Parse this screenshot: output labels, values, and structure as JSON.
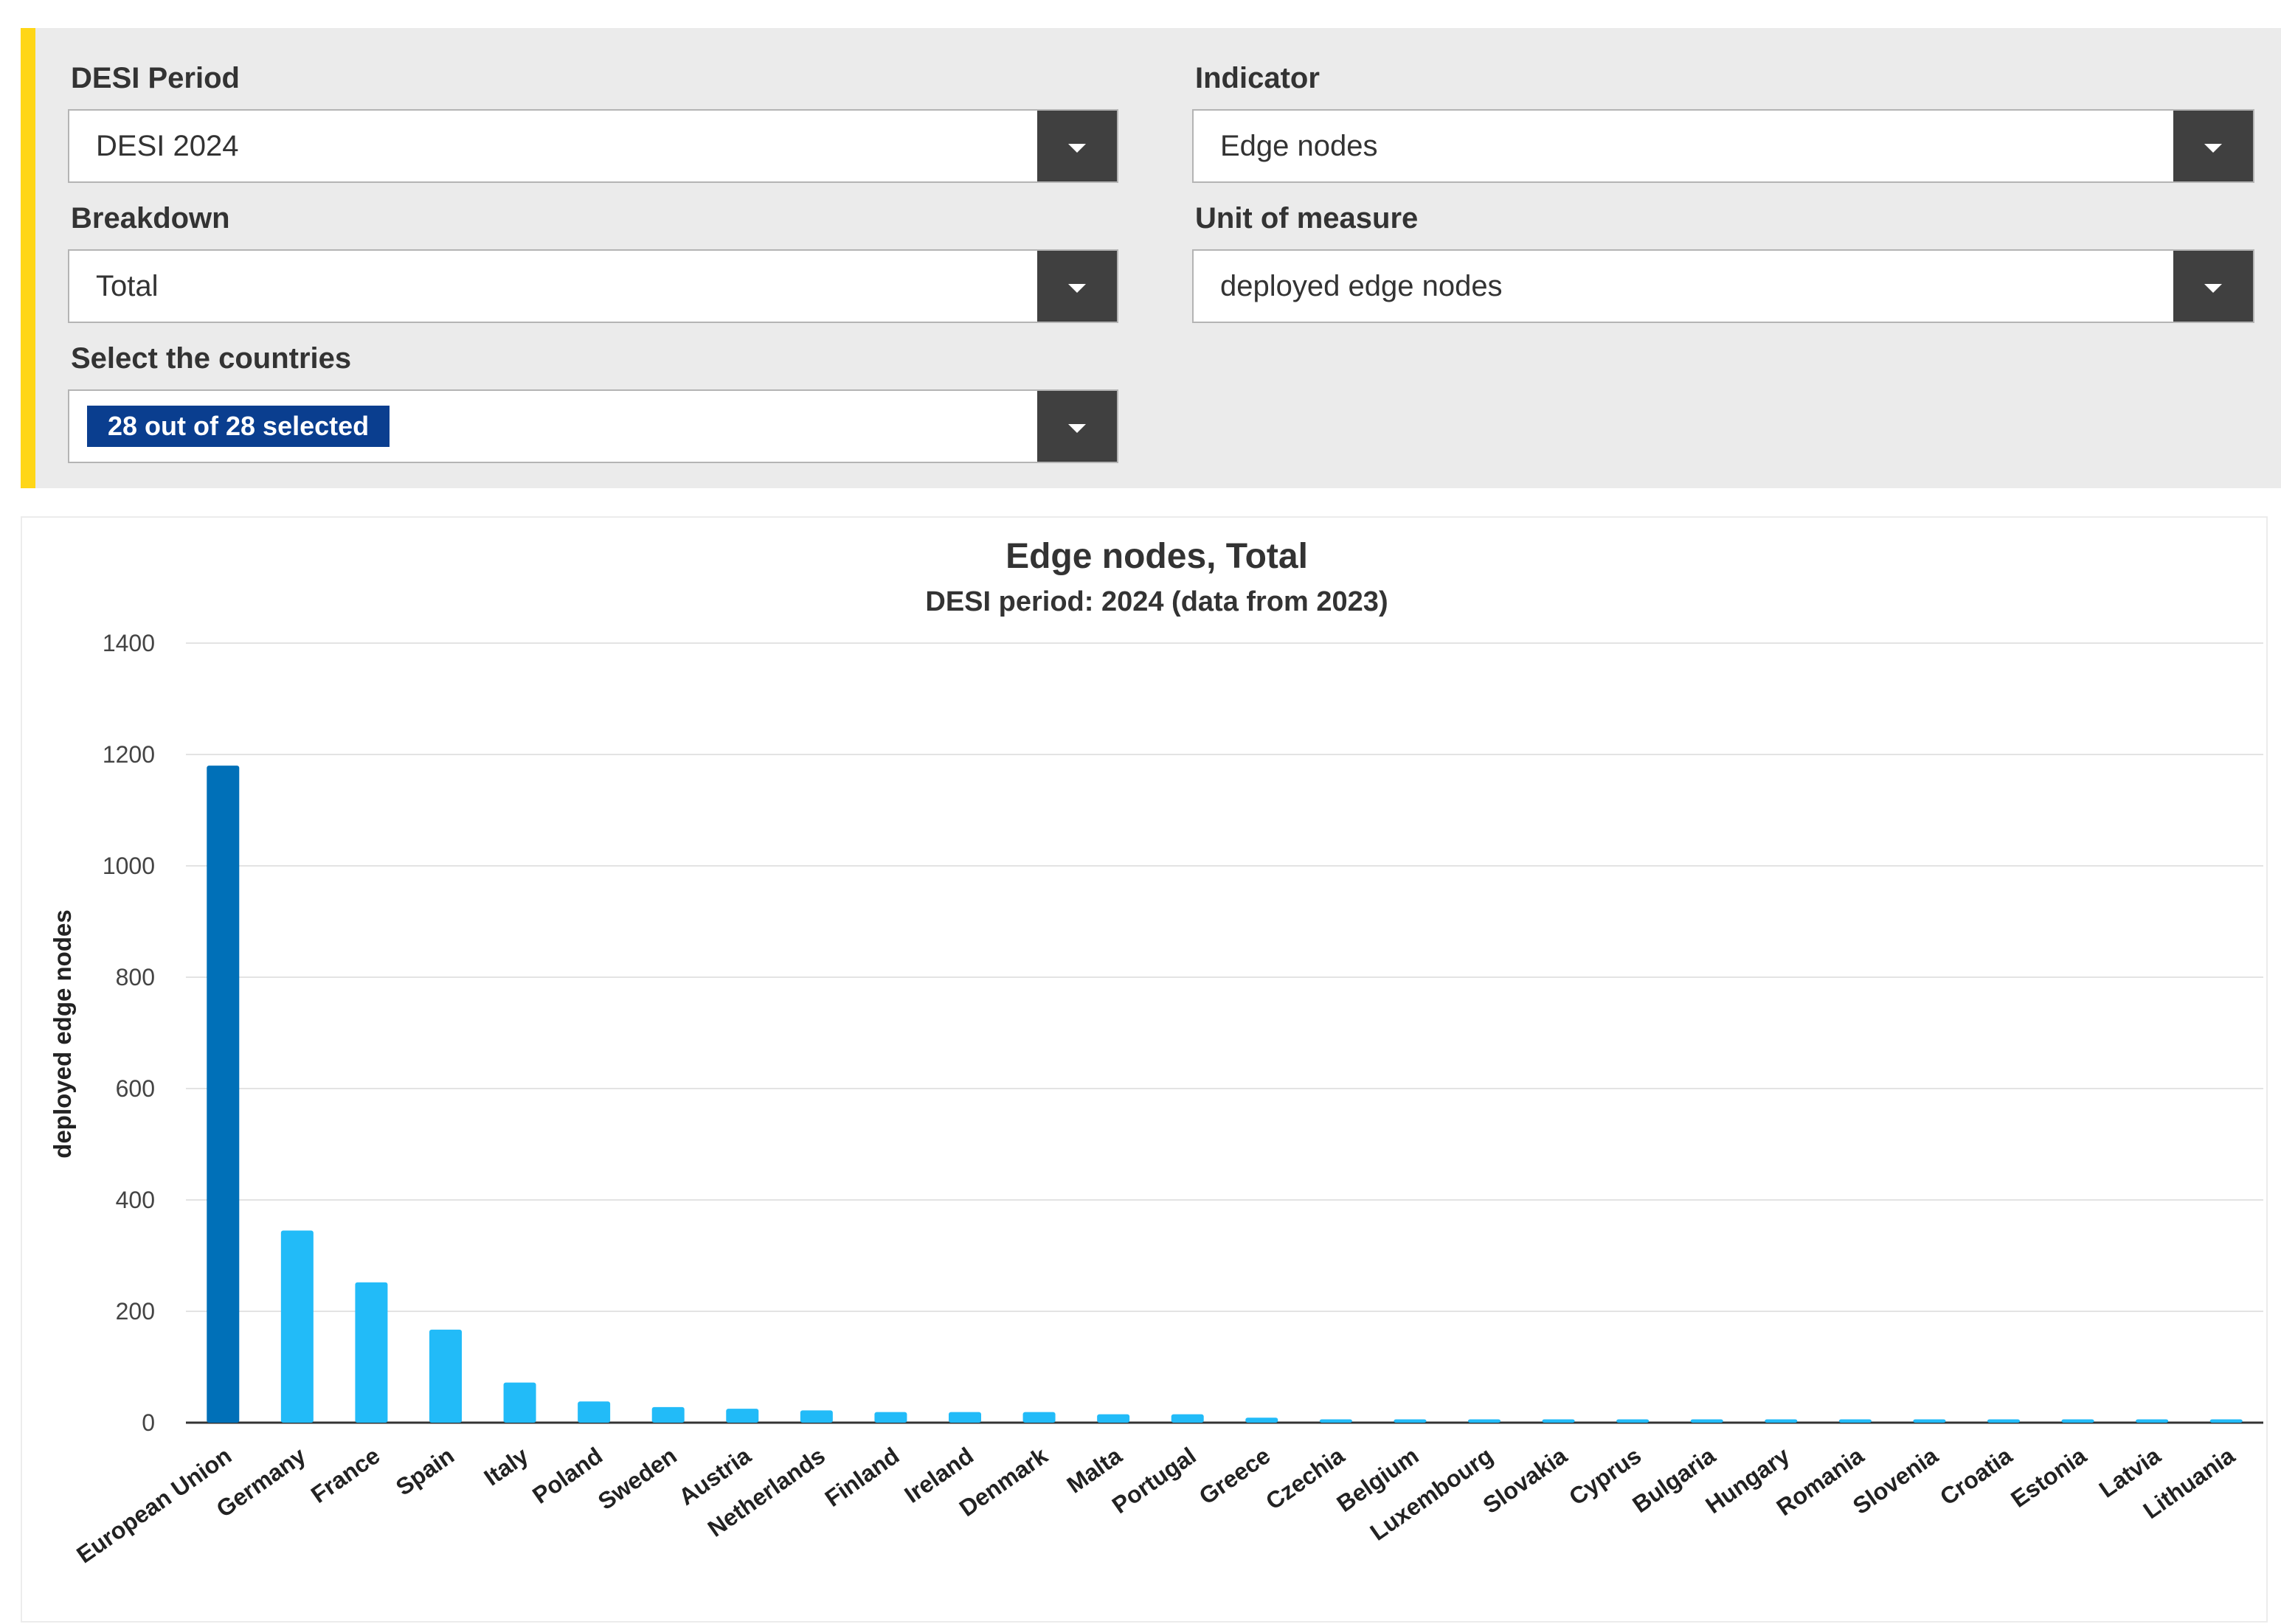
{
  "filters": {
    "desi_period": {
      "label": "DESI Period",
      "value": "DESI 2024"
    },
    "indicator": {
      "label": "Indicator",
      "value": "Edge nodes"
    },
    "breakdown": {
      "label": "Breakdown",
      "value": "Total"
    },
    "unit": {
      "label": "Unit of measure",
      "value": "deployed edge nodes"
    },
    "countries": {
      "label": "Select the countries",
      "badge": "28 out of 28 selected"
    }
  },
  "colors": {
    "accent": "#ffd617",
    "eu_bar": "#0070b8",
    "country_bar": "#22bbf8",
    "badge": "#0a3e8f"
  },
  "chart_data": {
    "type": "bar",
    "title": "Edge nodes, Total",
    "subtitle": "DESI period: 2024 (data from 2023)",
    "ylabel": "deployed edge nodes",
    "xlabel": "",
    "ylim": [
      0,
      1400
    ],
    "yticks": [
      0,
      200,
      400,
      600,
      800,
      1000,
      1200,
      1400
    ],
    "grid": true,
    "categories": [
      "European Union",
      "Germany",
      "France",
      "Spain",
      "Italy",
      "Poland",
      "Sweden",
      "Austria",
      "Netherlands",
      "Finland",
      "Ireland",
      "Denmark",
      "Malta",
      "Portugal",
      "Greece",
      "Czechia",
      "Belgium",
      "Luxembourg",
      "Slovakia",
      "Cyprus",
      "Bulgaria",
      "Hungary",
      "Romania",
      "Slovenia",
      "Croatia",
      "Estonia",
      "Latvia",
      "Lithuania"
    ],
    "values": [
      1180,
      345,
      252,
      167,
      72,
      38,
      28,
      25,
      22,
      19,
      19,
      19,
      15,
      15,
      9,
      6,
      6,
      6,
      6,
      6,
      6,
      6,
      6,
      6,
      6,
      6,
      6,
      6
    ]
  }
}
